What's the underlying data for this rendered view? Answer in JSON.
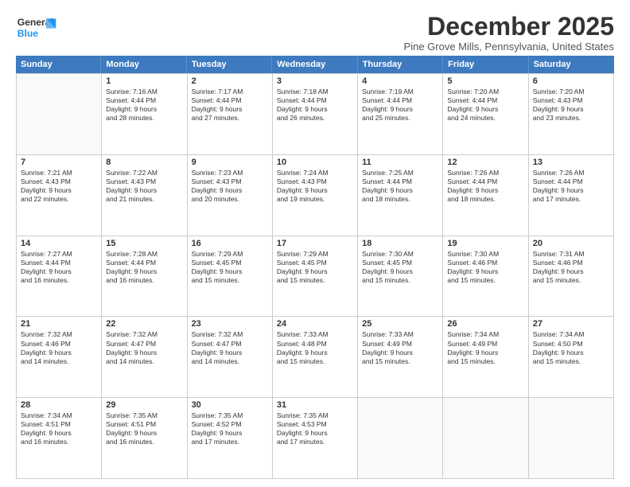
{
  "logo": {
    "line1": "General",
    "line2": "Blue"
  },
  "title": "December 2025",
  "subtitle": "Pine Grove Mills, Pennsylvania, United States",
  "days_of_week": [
    "Sunday",
    "Monday",
    "Tuesday",
    "Wednesday",
    "Thursday",
    "Friday",
    "Saturday"
  ],
  "weeks": [
    [
      {
        "day": "",
        "empty": true,
        "lines": []
      },
      {
        "day": "1",
        "lines": [
          "Sunrise: 7:16 AM",
          "Sunset: 4:44 PM",
          "Daylight: 9 hours",
          "and 28 minutes."
        ]
      },
      {
        "day": "2",
        "lines": [
          "Sunrise: 7:17 AM",
          "Sunset: 4:44 PM",
          "Daylight: 9 hours",
          "and 27 minutes."
        ]
      },
      {
        "day": "3",
        "lines": [
          "Sunrise: 7:18 AM",
          "Sunset: 4:44 PM",
          "Daylight: 9 hours",
          "and 26 minutes."
        ]
      },
      {
        "day": "4",
        "lines": [
          "Sunrise: 7:19 AM",
          "Sunset: 4:44 PM",
          "Daylight: 9 hours",
          "and 25 minutes."
        ]
      },
      {
        "day": "5",
        "lines": [
          "Sunrise: 7:20 AM",
          "Sunset: 4:44 PM",
          "Daylight: 9 hours",
          "and 24 minutes."
        ]
      },
      {
        "day": "6",
        "lines": [
          "Sunrise: 7:20 AM",
          "Sunset: 4:43 PM",
          "Daylight: 9 hours",
          "and 23 minutes."
        ]
      }
    ],
    [
      {
        "day": "7",
        "lines": [
          "Sunrise: 7:21 AM",
          "Sunset: 4:43 PM",
          "Daylight: 9 hours",
          "and 22 minutes."
        ]
      },
      {
        "day": "8",
        "lines": [
          "Sunrise: 7:22 AM",
          "Sunset: 4:43 PM",
          "Daylight: 9 hours",
          "and 21 minutes."
        ]
      },
      {
        "day": "9",
        "lines": [
          "Sunrise: 7:23 AM",
          "Sunset: 4:43 PM",
          "Daylight: 9 hours",
          "and 20 minutes."
        ]
      },
      {
        "day": "10",
        "lines": [
          "Sunrise: 7:24 AM",
          "Sunset: 4:43 PM",
          "Daylight: 9 hours",
          "and 19 minutes."
        ]
      },
      {
        "day": "11",
        "lines": [
          "Sunrise: 7:25 AM",
          "Sunset: 4:44 PM",
          "Daylight: 9 hours",
          "and 18 minutes."
        ]
      },
      {
        "day": "12",
        "lines": [
          "Sunrise: 7:26 AM",
          "Sunset: 4:44 PM",
          "Daylight: 9 hours",
          "and 18 minutes."
        ]
      },
      {
        "day": "13",
        "lines": [
          "Sunrise: 7:26 AM",
          "Sunset: 4:44 PM",
          "Daylight: 9 hours",
          "and 17 minutes."
        ]
      }
    ],
    [
      {
        "day": "14",
        "lines": [
          "Sunrise: 7:27 AM",
          "Sunset: 4:44 PM",
          "Daylight: 9 hours",
          "and 16 minutes."
        ]
      },
      {
        "day": "15",
        "lines": [
          "Sunrise: 7:28 AM",
          "Sunset: 4:44 PM",
          "Daylight: 9 hours",
          "and 16 minutes."
        ]
      },
      {
        "day": "16",
        "lines": [
          "Sunrise: 7:29 AM",
          "Sunset: 4:45 PM",
          "Daylight: 9 hours",
          "and 15 minutes."
        ]
      },
      {
        "day": "17",
        "lines": [
          "Sunrise: 7:29 AM",
          "Sunset: 4:45 PM",
          "Daylight: 9 hours",
          "and 15 minutes."
        ]
      },
      {
        "day": "18",
        "lines": [
          "Sunrise: 7:30 AM",
          "Sunset: 4:45 PM",
          "Daylight: 9 hours",
          "and 15 minutes."
        ]
      },
      {
        "day": "19",
        "lines": [
          "Sunrise: 7:30 AM",
          "Sunset: 4:46 PM",
          "Daylight: 9 hours",
          "and 15 minutes."
        ]
      },
      {
        "day": "20",
        "lines": [
          "Sunrise: 7:31 AM",
          "Sunset: 4:46 PM",
          "Daylight: 9 hours",
          "and 15 minutes."
        ]
      }
    ],
    [
      {
        "day": "21",
        "lines": [
          "Sunrise: 7:32 AM",
          "Sunset: 4:46 PM",
          "Daylight: 9 hours",
          "and 14 minutes."
        ]
      },
      {
        "day": "22",
        "lines": [
          "Sunrise: 7:32 AM",
          "Sunset: 4:47 PM",
          "Daylight: 9 hours",
          "and 14 minutes."
        ]
      },
      {
        "day": "23",
        "lines": [
          "Sunrise: 7:32 AM",
          "Sunset: 4:47 PM",
          "Daylight: 9 hours",
          "and 14 minutes."
        ]
      },
      {
        "day": "24",
        "lines": [
          "Sunrise: 7:33 AM",
          "Sunset: 4:48 PM",
          "Daylight: 9 hours",
          "and 15 minutes."
        ]
      },
      {
        "day": "25",
        "lines": [
          "Sunrise: 7:33 AM",
          "Sunset: 4:49 PM",
          "Daylight: 9 hours",
          "and 15 minutes."
        ]
      },
      {
        "day": "26",
        "lines": [
          "Sunrise: 7:34 AM",
          "Sunset: 4:49 PM",
          "Daylight: 9 hours",
          "and 15 minutes."
        ]
      },
      {
        "day": "27",
        "lines": [
          "Sunrise: 7:34 AM",
          "Sunset: 4:50 PM",
          "Daylight: 9 hours",
          "and 15 minutes."
        ]
      }
    ],
    [
      {
        "day": "28",
        "lines": [
          "Sunrise: 7:34 AM",
          "Sunset: 4:51 PM",
          "Daylight: 9 hours",
          "and 16 minutes."
        ]
      },
      {
        "day": "29",
        "lines": [
          "Sunrise: 7:35 AM",
          "Sunset: 4:51 PM",
          "Daylight: 9 hours",
          "and 16 minutes."
        ]
      },
      {
        "day": "30",
        "lines": [
          "Sunrise: 7:35 AM",
          "Sunset: 4:52 PM",
          "Daylight: 9 hours",
          "and 17 minutes."
        ]
      },
      {
        "day": "31",
        "lines": [
          "Sunrise: 7:35 AM",
          "Sunset: 4:53 PM",
          "Daylight: 9 hours",
          "and 17 minutes."
        ]
      },
      {
        "day": "",
        "empty": true,
        "lines": []
      },
      {
        "day": "",
        "empty": true,
        "lines": []
      },
      {
        "day": "",
        "empty": true,
        "lines": []
      }
    ]
  ]
}
